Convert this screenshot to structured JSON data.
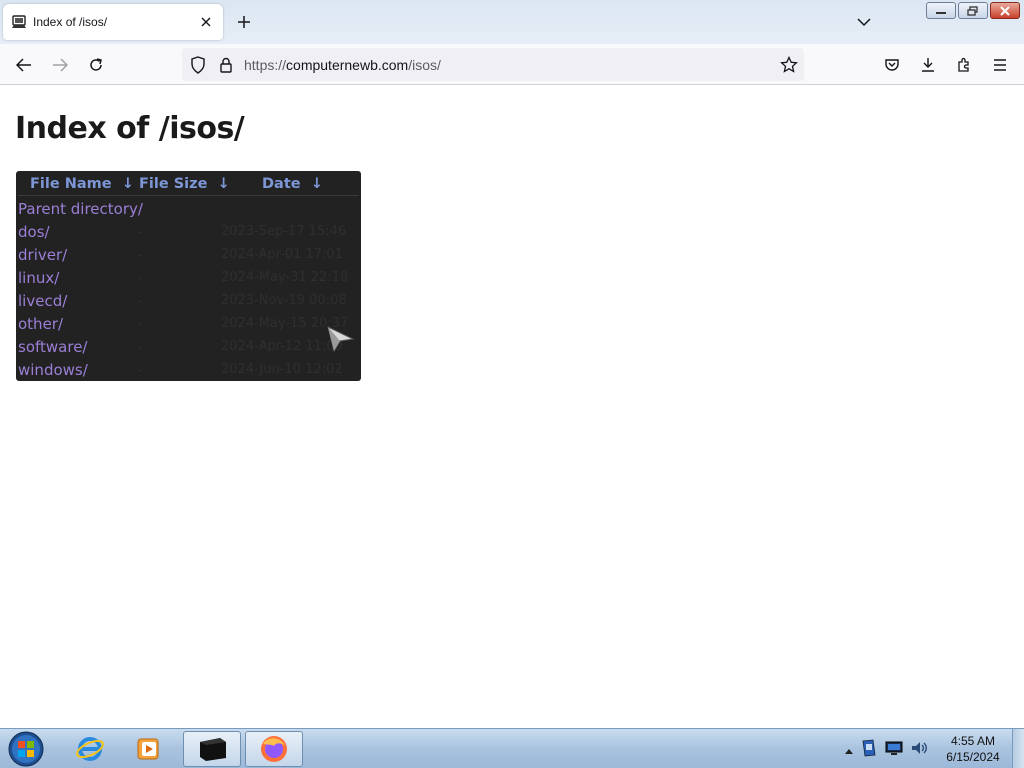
{
  "window": {
    "tab_title": "Index of /isos/",
    "tab_close_icon": "close-icon",
    "new_tab_icon": "plus-icon",
    "tab_list_icon": "chevron-down-icon"
  },
  "nav": {
    "url_scheme": "https://",
    "url_host": "computernewb.com",
    "url_path": "/isos/"
  },
  "page": {
    "title": "Index of /isos/",
    "columns": [
      {
        "label": "File Name",
        "sort": "↓"
      },
      {
        "label": "File Size",
        "sort": "↓"
      },
      {
        "label": "Date",
        "sort": "↓"
      }
    ],
    "entries": [
      {
        "name": "Parent directory/",
        "size": "",
        "date": ""
      },
      {
        "name": "dos/",
        "size": "-",
        "date": "2023-Sep-17 15:46"
      },
      {
        "name": "driver/",
        "size": "-",
        "date": "2024-Apr-01 17:01"
      },
      {
        "name": "linux/",
        "size": "-",
        "date": "2024-May-31 22:18"
      },
      {
        "name": "livecd/",
        "size": "-",
        "date": "2023-Nov-19 00:08"
      },
      {
        "name": "other/",
        "size": "-",
        "date": "2024-May-15 20:37"
      },
      {
        "name": "software/",
        "size": "-",
        "date": "2024-Apr-12 11:09"
      },
      {
        "name": "windows/",
        "size": "-",
        "date": "2024-Jun-10 12:02"
      }
    ]
  },
  "taskbar": {
    "clock_time": "4:55 AM",
    "clock_date": "6/15/2024"
  },
  "colors": {
    "listing_bg": "#222222",
    "header_text": "#7d97d6",
    "link": "#9b7fd6"
  }
}
